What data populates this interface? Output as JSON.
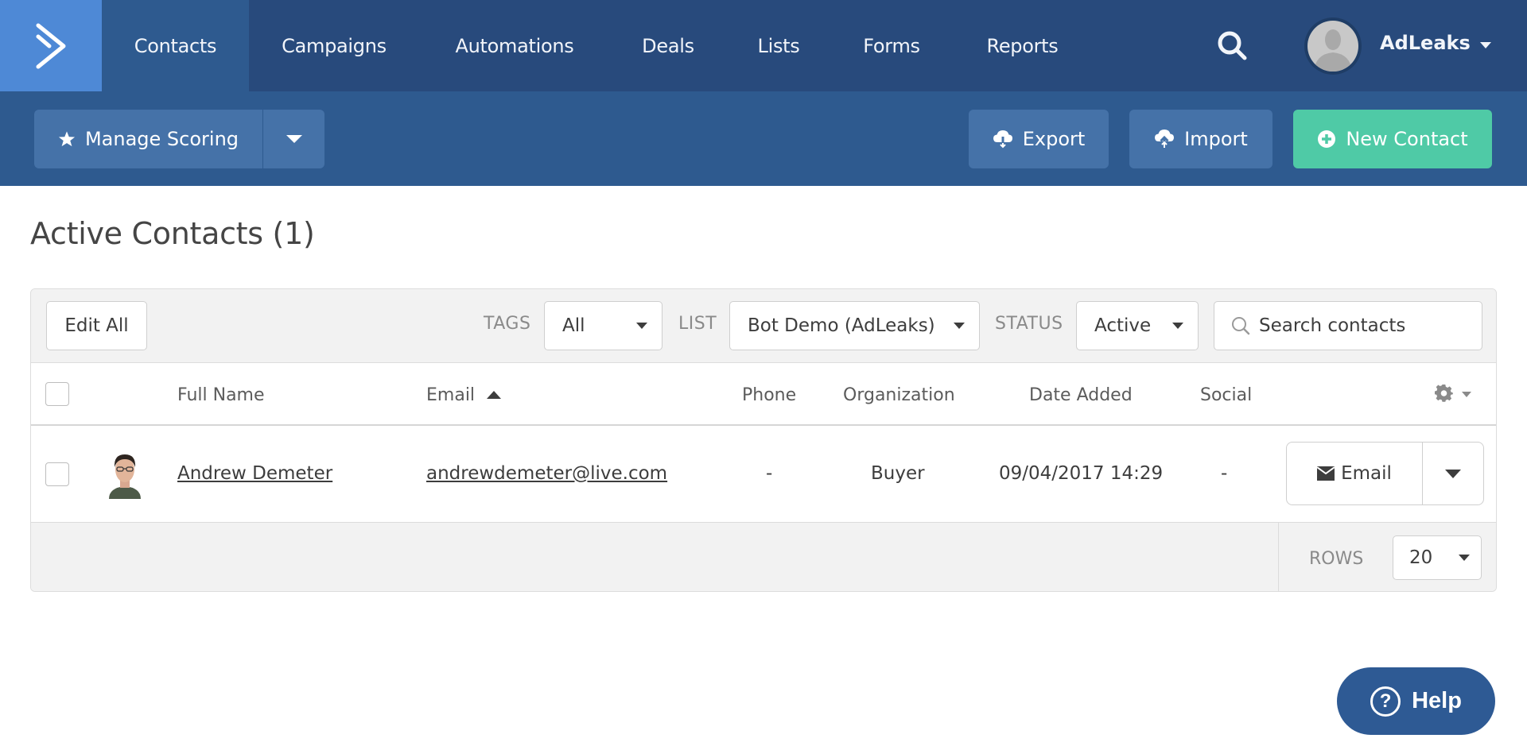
{
  "nav": {
    "logo": "activecampaign-logo",
    "tabs": [
      {
        "label": "Contacts",
        "active": true
      },
      {
        "label": "Campaigns",
        "active": false
      },
      {
        "label": "Automations",
        "active": false
      },
      {
        "label": "Deals",
        "active": false
      },
      {
        "label": "Lists",
        "active": false
      },
      {
        "label": "Forms",
        "active": false
      },
      {
        "label": "Reports",
        "active": false
      }
    ],
    "search_icon": "search-icon",
    "user": {
      "name": "AdLeaks",
      "avatar": "default-user-avatar"
    }
  },
  "toolbar": {
    "manage_scoring_label": "Manage Scoring",
    "export_label": "Export",
    "import_label": "Import",
    "new_contact_label": "New Contact"
  },
  "page": {
    "title": "Active Contacts (1)"
  },
  "filters": {
    "edit_all_label": "Edit All",
    "tags_label": "TAGS",
    "tags_value": "All",
    "list_label": "LIST",
    "list_value": "Bot Demo (AdLeaks)",
    "status_label": "STATUS",
    "status_value": "Active",
    "search_placeholder": "Search contacts"
  },
  "table": {
    "columns": {
      "full_name": "Full Name",
      "email": "Email",
      "phone": "Phone",
      "organization": "Organization",
      "date_added": "Date Added",
      "social": "Social"
    },
    "sort": {
      "column": "Email",
      "direction": "ascending"
    },
    "rows": [
      {
        "full_name": "Andrew Demeter",
        "email": "andrewdemeter@live.com",
        "phone": "-",
        "organization": "Buyer",
        "date_added": "09/04/2017 14:29",
        "social": "-",
        "action_label": "Email"
      }
    ],
    "footer": {
      "rows_label": "ROWS",
      "rows_value": "20"
    }
  },
  "help": {
    "label": "Help"
  },
  "colors": {
    "nav_bg": "#284a7c",
    "subheader_bg": "#2e5a8f",
    "logo_bg": "#4e89d6",
    "secondary_button": "#4572a8",
    "primary_button": "#4fcaa6",
    "help_button": "#2e5a94"
  }
}
